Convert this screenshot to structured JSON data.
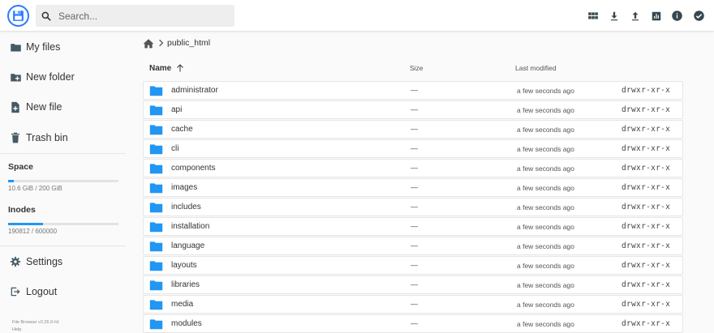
{
  "search": {
    "placeholder": "Search..."
  },
  "toolbar": [
    {
      "name": "grid-view-icon"
    },
    {
      "name": "download-icon"
    },
    {
      "name": "upload-icon"
    },
    {
      "name": "bar-chart-icon"
    },
    {
      "name": "info-icon"
    },
    {
      "name": "select-check-icon"
    }
  ],
  "sidebar": {
    "items": [
      {
        "label": "My files",
        "icon": "folder-icon"
      },
      {
        "label": "New folder",
        "icon": "new-folder-icon"
      },
      {
        "label": "New file",
        "icon": "new-file-icon"
      },
      {
        "label": "Trash bin",
        "icon": "trash-icon"
      }
    ],
    "space": {
      "title": "Space",
      "text": "10.6 GiB / 200 GiB",
      "fraction": 0.053
    },
    "inodes": {
      "title": "Inodes",
      "text": "190812 / 600000",
      "fraction": 0.318
    },
    "settings": {
      "label": "Settings",
      "icon": "gear-icon"
    },
    "logout": {
      "label": "Logout",
      "icon": "logout-icon"
    },
    "footer": {
      "version": "File Browser v2.26.0-h1",
      "help": "Help"
    }
  },
  "breadcrumb": {
    "path": "public_html"
  },
  "columns": {
    "name": "Name",
    "size": "Size",
    "modified": "Last modified"
  },
  "accent": "#2196f3",
  "files": [
    {
      "name": "administrator",
      "size": "—",
      "modified": "a few seconds ago",
      "perm": "drwxr-xr-x"
    },
    {
      "name": "api",
      "size": "—",
      "modified": "a few seconds ago",
      "perm": "drwxr-xr-x"
    },
    {
      "name": "cache",
      "size": "—",
      "modified": "a few seconds ago",
      "perm": "drwxr-xr-x"
    },
    {
      "name": "cli",
      "size": "—",
      "modified": "a few seconds ago",
      "perm": "drwxr-xr-x"
    },
    {
      "name": "components",
      "size": "—",
      "modified": "a few seconds ago",
      "perm": "drwxr-xr-x"
    },
    {
      "name": "images",
      "size": "—",
      "modified": "a few seconds ago",
      "perm": "drwxr-xr-x"
    },
    {
      "name": "includes",
      "size": "—",
      "modified": "a few seconds ago",
      "perm": "drwxr-xr-x"
    },
    {
      "name": "installation",
      "size": "—",
      "modified": "a few seconds ago",
      "perm": "drwxr-xr-x"
    },
    {
      "name": "language",
      "size": "—",
      "modified": "a few seconds ago",
      "perm": "drwxr-xr-x"
    },
    {
      "name": "layouts",
      "size": "—",
      "modified": "a few seconds ago",
      "perm": "drwxr-xr-x"
    },
    {
      "name": "libraries",
      "size": "—",
      "modified": "a few seconds ago",
      "perm": "drwxr-xr-x"
    },
    {
      "name": "media",
      "size": "—",
      "modified": "a few seconds ago",
      "perm": "drwxr-xr-x"
    },
    {
      "name": "modules",
      "size": "—",
      "modified": "a few seconds ago",
      "perm": "drwxr-xr-x"
    }
  ]
}
